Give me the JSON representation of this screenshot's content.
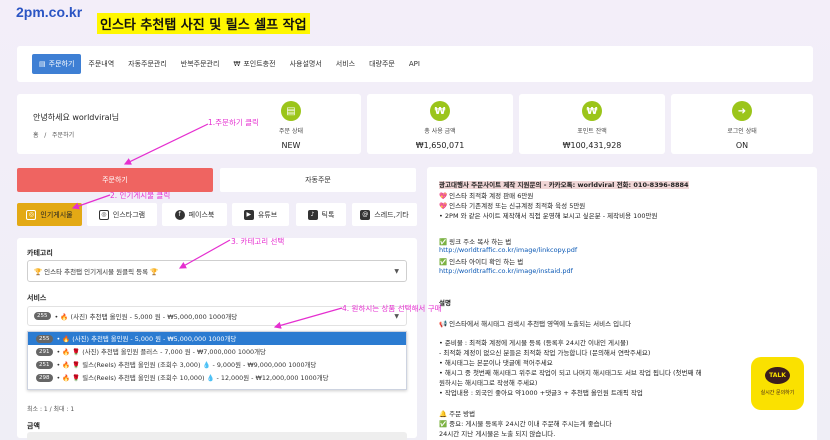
{
  "header": {
    "logo": "2pm.co.kr",
    "title": "인스타 추천탭 사진 및 릴스 셀프 작업"
  },
  "nav": [
    {
      "label": "주문하기",
      "icon": "cart-icon",
      "active": true
    },
    {
      "label": "주문내역"
    },
    {
      "label": "자동주문관리"
    },
    {
      "label": "반복주문관리"
    },
    {
      "label": "포인트충전",
      "icon": "won-icon"
    },
    {
      "label": "사용설명서"
    },
    {
      "label": "서비스"
    },
    {
      "label": "대량주문"
    },
    {
      "label": "API"
    }
  ],
  "greeting": {
    "text": "안녕하세요 worldviral님",
    "breadcrumb_home": "홈",
    "breadcrumb_sep": "/",
    "breadcrumb_page": "주문하기"
  },
  "stats": [
    {
      "label": "주문 상태",
      "value": "NEW",
      "icon": "document-icon"
    },
    {
      "label": "총 사용 금액",
      "value": "₩1,650,071",
      "icon": "won-icon"
    },
    {
      "label": "포인트 잔액",
      "value": "₩100,431,928",
      "icon": "won-icon"
    },
    {
      "label": "로그인 상태",
      "value": "ON",
      "icon": "login-icon"
    }
  ],
  "order_tabs": {
    "order": "주문하기",
    "auto": "자동주문"
  },
  "categories": [
    {
      "label": "인기게시물",
      "icon": "instagram-icon",
      "active": true
    },
    {
      "label": "인스타그램",
      "icon": "instagram-icon"
    },
    {
      "label": "페이스북",
      "icon": "facebook-icon"
    },
    {
      "label": "유튜브",
      "icon": "youtube-icon"
    },
    {
      "label": "틱톡",
      "icon": "tiktok-icon"
    },
    {
      "label": "스레드,기타",
      "icon": "threads-icon"
    }
  ],
  "form": {
    "category_label": "카테고리",
    "category_value": "🏆 인스타 추천탭 인기게시물 원클릭 등록 🏆",
    "service_label": "서비스",
    "service_badge": "255",
    "service_value": "• 🔥 (사진) 추천탭 올인원 - 5,000 원 - ₩5,000,000 1000개당",
    "min_max": "최소 : 1 / 최대 : 1",
    "amount_label": "금액"
  },
  "dropdown": [
    {
      "badge": "255",
      "text": "• 🔥 (사진) 추천탭 올인원 - 5,000 원 - ₩5,000,000 1000개당",
      "selected": true
    },
    {
      "badge": "291",
      "text": "• 🔥 🌹 (사진) 추천탭 올인원 플러스 - 7,000 원 - ₩7,000,000 1000개당"
    },
    {
      "badge": "251",
      "text": "• 🔥 🌹 릴스(Reels) 추천탭 올인원 (조회수 3,000) 💧 - 9,000원 - ₩9,000,000 1000개당"
    },
    {
      "badge": "298",
      "text": "• 🔥 🌹 릴스(Reels) 추천탭 올인원 (조회수 10,000) 💧 - 12,000원 - ₩12,000,000 1000개당"
    }
  ],
  "right": {
    "ad_line": "광고대행사 주문사이트 제작 지원문의 - 카카오톡: worldviral 전화: 010-8396-8884",
    "lines": [
      "💖 인스타 최적화 계정 판매 6만원",
      "💖 인스타 기존계정 또는 신규계정 최적화 육성 5만원",
      "• 2PM 와 같은 사이트 제작해서 직접 운영해 보시고 싶은분 - 제작비용 100만원"
    ],
    "copy_title": "✅ 링크 주소 복사 하는 법",
    "copy_link": "http://worldtraffic.co.kr/image/linkcopy.pdf",
    "id_title": "✅ 인스타 아이디 확인 하는 법",
    "id_link": "http://worldtraffic.co.kr/image/instaid.pdf",
    "desc_label": "설명",
    "desc_lines": [
      "📢 인스타에서 해시태그 검색시 추천탭 영역에 노출되는 서비스 입니다",
      "• 준비물 : 최적화 계정에 게시물 등록 (등록후 24시간 이내인 게시물)",
      "- 최적화 계정이 없으신 분들은 최적화 작업 가능합니다 (문의해서 연락주세요)",
      "• 해시태그는 본문이나 댓글에 적어주세요",
      "• 해시그 중 첫번째 해시태그 위주로 작업이 되고 나머지 해시태그도 서브 작업 됩니다 (첫번째 해",
      "원하시는 해시태그로 작성해 주세요)",
      "• 작업내용 : 외국인 좋아요 약1000 +댓글3 + 추천탭 올인원 트래픽 작업",
      "🔔 주문 방법",
      "✅ 중요: 게시물 등록후 24시간 이내 주문해 주시는게 좋습니다",
      "24시간 지난 게시물은 노출 되지 않습니다."
    ]
  },
  "kakao": {
    "logo": "TALK",
    "label": "실시간 문의하기"
  },
  "annotations": {
    "a1": "1.주문하기 클릭",
    "a2": "2. 인기게시물 클릭",
    "a3": "3. 카테고리 선택",
    "a4": "4. 원하시는 상품 선택해서 구매"
  },
  "colors": {
    "accent_red": "#ef6461",
    "accent_yellow": "#e3a915",
    "nav_active": "#3e7fd4",
    "annotation": "#e52fd0",
    "kakao": "#fae100"
  }
}
